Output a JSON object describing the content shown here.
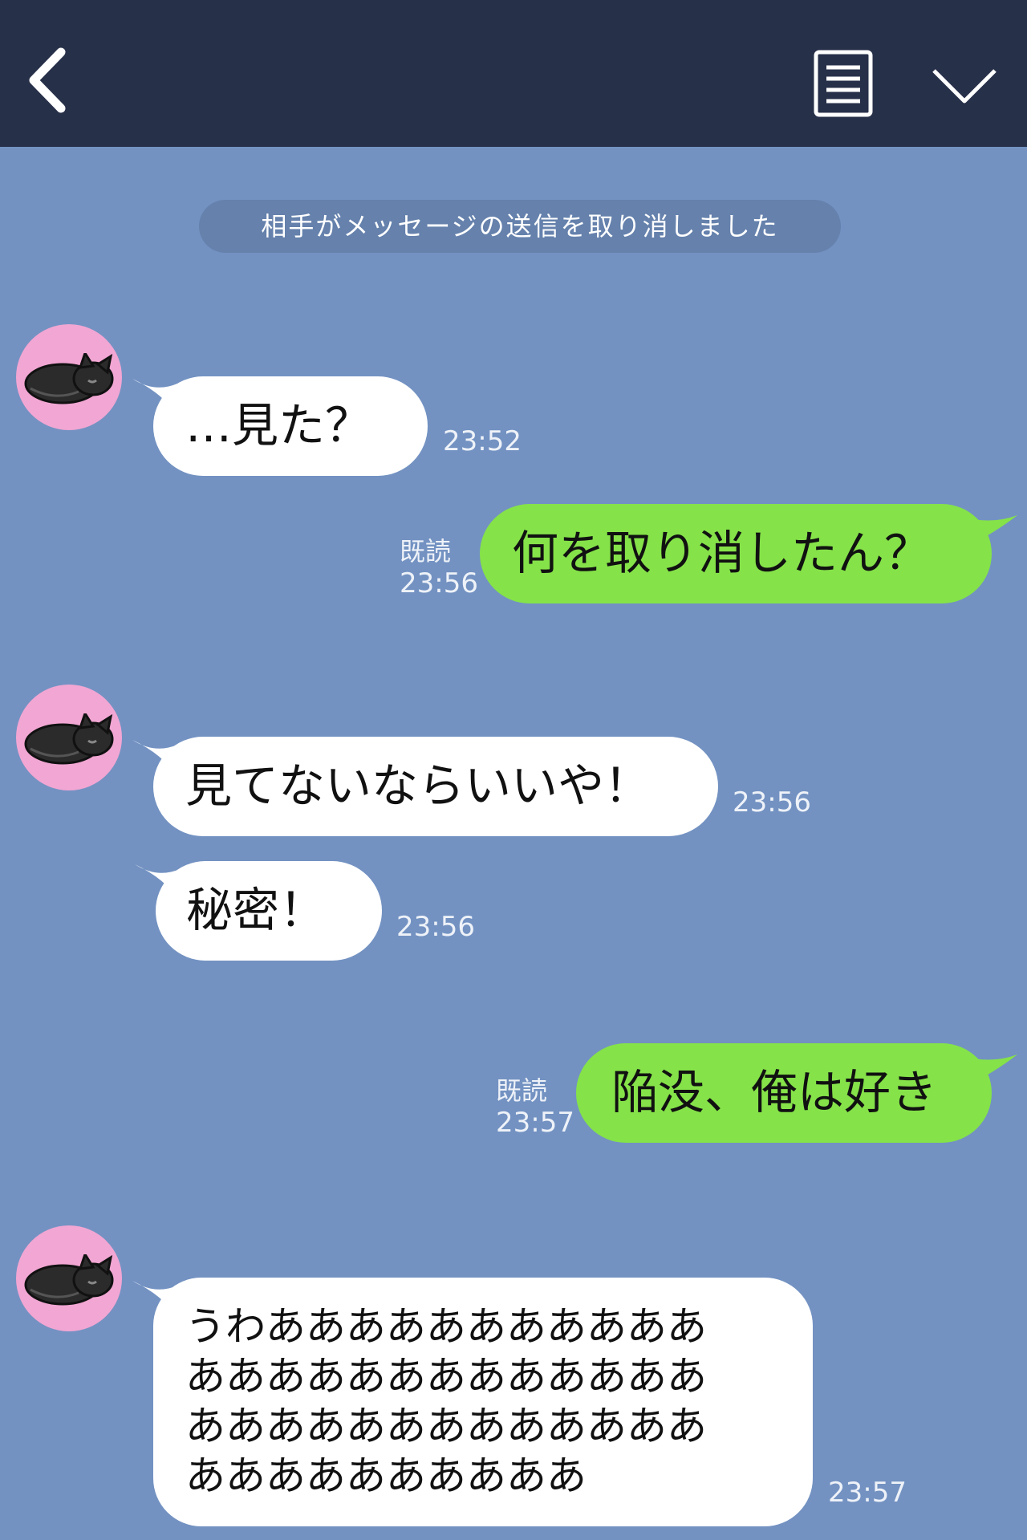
{
  "header": {
    "back_icon": "chevron-left-icon",
    "menu_icon": "note-icon",
    "collapse_icon": "chevron-down-icon"
  },
  "notice": "相手がメッセージの送信を取り消しました",
  "messages": [
    {
      "side": "in",
      "text": "…見た？",
      "time": "23:52"
    },
    {
      "side": "out",
      "read": "既読",
      "text": "何を取り消したん？",
      "time": "23:56"
    },
    {
      "side": "in",
      "text": "見てないならいいや！",
      "time": "23:56"
    },
    {
      "side": "in",
      "text": "秘密！",
      "time": "23:56"
    },
    {
      "side": "out",
      "read": "既読",
      "text": "陥没、俺は好き",
      "time": "23:57"
    },
    {
      "side": "in",
      "lines": [
        "うわあああああああああああ",
        "あああああああああああああ",
        "あああああああああああああ",
        "ああああああああああ"
      ],
      "time": "23:57"
    }
  ],
  "colors": {
    "background": "#7392c2",
    "header": "#273049",
    "incoming_bubble": "#ffffff",
    "outgoing_bubble": "#85e249",
    "avatar": "#f2a6d3"
  }
}
